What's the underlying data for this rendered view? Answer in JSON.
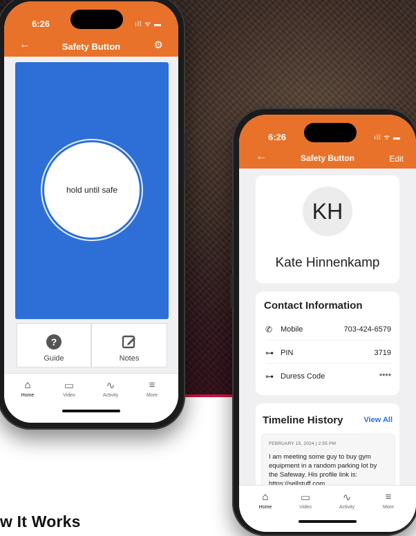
{
  "footer": {
    "heading": "w It Works"
  },
  "phone1": {
    "status": {
      "time": "6:26",
      "signal": "ıll ᯤ ▬",
      "title": "Safety Button",
      "back": "←",
      "gear": "⚙"
    },
    "hold_label": "hold until safe",
    "tiles": [
      {
        "label": "Guide",
        "icon": "question-icon"
      },
      {
        "label": "Notes",
        "icon": "edit-icon"
      }
    ],
    "tabs": [
      {
        "label": "Home",
        "icon": "home-icon",
        "active": true
      },
      {
        "label": "Video",
        "icon": "video-icon",
        "active": false
      },
      {
        "label": "Activity",
        "icon": "activity-icon",
        "active": false
      },
      {
        "label": "More",
        "icon": "menu-icon",
        "active": false
      }
    ]
  },
  "phone2": {
    "status": {
      "time": "6:26",
      "signal": "ıll ᯤ ▬",
      "title": "Safety Button",
      "back": "←",
      "edit": "Edit"
    },
    "profile": {
      "initials": "KH",
      "name": "Kate Hinnenkamp"
    },
    "contact": {
      "title": "Contact Information",
      "rows": [
        {
          "icon": "phone-icon",
          "label": "Mobile",
          "value": "703-424-6579"
        },
        {
          "icon": "key-icon",
          "label": "PIN",
          "value": "3719"
        },
        {
          "icon": "key-icon",
          "label": "Duress Code",
          "value": "****"
        }
      ]
    },
    "timeline": {
      "title": "Timeline History",
      "view_all": "View All",
      "entry": {
        "date": "FEBRUARY 15, 2024 | 2:55 PM",
        "text": "I am meeting some guy to buy gym equipment in a random parking lot by the Safeway. His profile link is: https://sellstuff.com"
      }
    },
    "tabs": [
      {
        "label": "Home",
        "icon": "home-icon",
        "active": true
      },
      {
        "label": "Video",
        "icon": "video-icon",
        "active": false
      },
      {
        "label": "Activity",
        "icon": "activity-icon",
        "active": false
      },
      {
        "label": "More",
        "icon": "menu-icon",
        "active": false
      }
    ]
  },
  "colors": {
    "accent": "#e8722a",
    "blue": "#2d6fd6",
    "brand_line": "#c4153d"
  }
}
